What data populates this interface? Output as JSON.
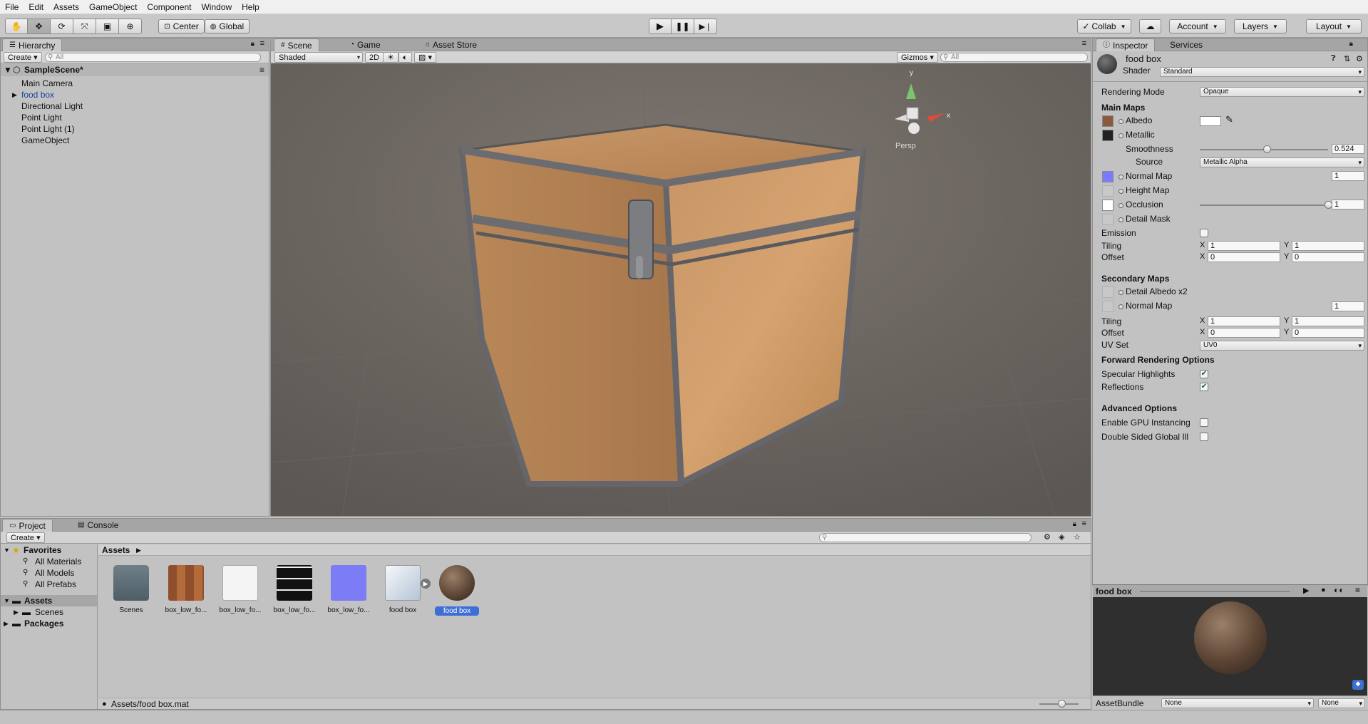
{
  "menu": [
    "File",
    "Edit",
    "Assets",
    "GameObject",
    "Component",
    "Window",
    "Help"
  ],
  "toolbar": {
    "pivot": "Center",
    "space": "Global",
    "collab": "Collab",
    "account": "Account",
    "layers": "Layers",
    "layout": "Layout"
  },
  "hierarchy": {
    "tab": "Hierarchy",
    "create": "Create",
    "search_placeholder": "All",
    "scene": "SampleScene*",
    "items": [
      "Main Camera",
      "food box",
      "Directional Light",
      "Point Light",
      "Point Light (1)",
      "GameObject"
    ]
  },
  "scene_view": {
    "tabs": [
      "Scene",
      "Game",
      "Asset Store"
    ],
    "shading": "Shaded",
    "mode_2d": "2D",
    "gizmos": "Gizmos",
    "search_placeholder": "All",
    "persp": "Persp",
    "axis_y": "y",
    "axis_x": "x"
  },
  "inspector": {
    "tabs": [
      "Inspector",
      "Services"
    ],
    "material_name": "food box",
    "shader_label": "Shader",
    "shader_value": "Standard",
    "rendering_mode_label": "Rendering Mode",
    "rendering_mode_value": "Opaque",
    "main_maps": "Main Maps",
    "albedo": "Albedo",
    "metallic": "Metallic",
    "smoothness_label": "Smoothness",
    "smoothness_value": "0.524",
    "smoothness_level": 0.524,
    "source_label": "Source",
    "source_value": "Metallic Alpha",
    "normal_map": "Normal Map",
    "normal_map_value": "1",
    "height_map": "Height Map",
    "occlusion": "Occlusion",
    "occlusion_value": "1",
    "occlusion_level": 1,
    "detail_mask": "Detail Mask",
    "emission": "Emission",
    "tiling": "Tiling",
    "offset": "Offset",
    "x": "X",
    "y": "Y",
    "tiling_x": "1",
    "tiling_y": "1",
    "offset_x": "0",
    "offset_y": "0",
    "secondary_maps": "Secondary Maps",
    "detail_albedo": "Detail Albedo x2",
    "sec_normal_map": "Normal Map",
    "sec_normal_value": "1",
    "sec_tiling_x": "1",
    "sec_tiling_y": "1",
    "sec_offset_x": "0",
    "sec_offset_y": "0",
    "uv_set_label": "UV Set",
    "uv_set_value": "UV0",
    "forward_options": "Forward Rendering Options",
    "specular_highlights": "Specular Highlights",
    "reflections": "Reflections",
    "advanced_options": "Advanced Options",
    "gpu_instancing": "Enable GPU Instancing",
    "double_sided": "Double Sided Global Ill",
    "preview_title": "food box",
    "assetbundle_label": "AssetBundle",
    "assetbundle_value": "None",
    "assetbundle_variant": "None"
  },
  "project": {
    "tabs": [
      "Project",
      "Console"
    ],
    "create": "Create",
    "favorites": "Favorites",
    "fav_items": [
      "All Materials",
      "All Models",
      "All Prefabs"
    ],
    "assets_root": "Assets",
    "assets_children": [
      "Scenes"
    ],
    "packages": "Packages",
    "breadcrumb": "Assets",
    "assets": [
      "Scenes",
      "box_low_fo...",
      "box_low_fo...",
      "box_low_fo...",
      "box_low_fo...",
      "food box",
      "food box"
    ],
    "status_path": "Assets/food box.mat"
  },
  "colors": {
    "selection": "#3d6fd6",
    "panel": "#c2c2c2",
    "tab_bar": "#a5a5a5"
  }
}
